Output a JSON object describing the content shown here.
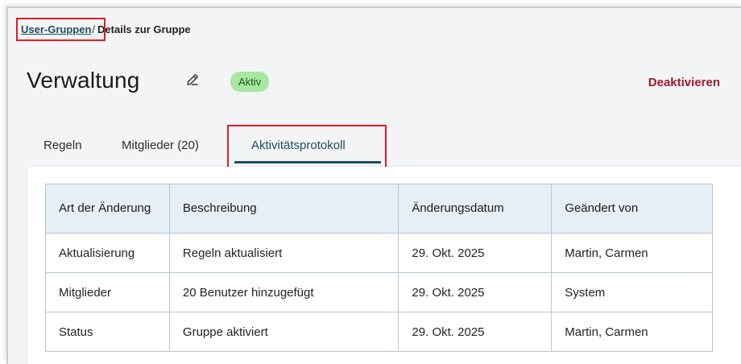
{
  "breadcrumb": {
    "parent": "User-Gruppen",
    "separator": "/",
    "current": "Details zur Gruppe"
  },
  "header": {
    "title": "Verwaltung",
    "status": "Aktiv",
    "deactivate_label": "Deaktivieren",
    "edit_icon": "pencil-icon"
  },
  "tabs": [
    {
      "label": "Regeln"
    },
    {
      "label": "Mitglieder (20)"
    },
    {
      "label": "Aktivitätsprotokoll",
      "active": true
    }
  ],
  "table": {
    "headers": [
      "Art der Änderung",
      "Beschreibung",
      "Änderungsdatum",
      "Geändert von"
    ],
    "rows": [
      [
        "Aktualisierung",
        "Regeln aktualisiert",
        "29. Okt. 2025",
        "Martin, Carmen"
      ],
      [
        "Mitglieder",
        "20 Benutzer hinzugefügt",
        "29. Okt. 2025",
        "System"
      ],
      [
        "Status",
        "Gruppe aktiviert",
        "29. Okt. 2025",
        "Martin, Carmen"
      ]
    ]
  },
  "colors": {
    "accent": "#1c4e5c",
    "danger": "#9b1c2c",
    "badge_bg": "#a8e6a1",
    "highlight": "#e01b24"
  }
}
